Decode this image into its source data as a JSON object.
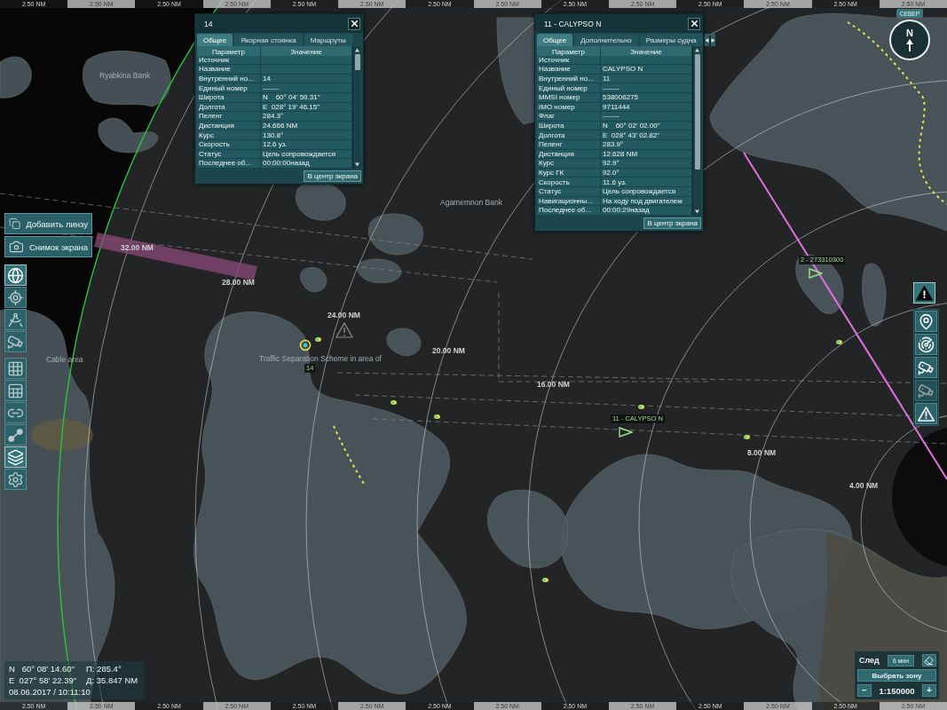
{
  "scale_bar_top": {
    "segments": [
      "2.50 NM",
      "2.50 NM",
      "2.50 NM",
      "2.50 NM",
      "2.50 NM",
      "2.50 NM",
      "2.50 NM",
      "2.50 NM",
      "2.50 NM",
      "2.50 NM",
      "2.50 NM",
      "2.50 NM",
      "2.50 NM",
      "2.50 NM"
    ]
  },
  "compass": {
    "badge": "СЕВЕР",
    "letter": "N"
  },
  "chart": {
    "place_names": [
      "Ryabkina Bank",
      "Agamemnon Bank",
      "Cable area",
      "Traffic Separation Scheme in area of"
    ],
    "range_labels": [
      "32.00 NM",
      "28.00 NM",
      "24.00 NM",
      "20.00 NM",
      "16.00 NM",
      "8.00 NM",
      "4.00 NM"
    ],
    "targets": [
      {
        "label": "14",
        "kind": "radar"
      },
      {
        "label": "11 - CALYPSO N",
        "kind": "ais"
      },
      {
        "label": "2 - 273310300",
        "kind": "ais"
      }
    ]
  },
  "windows": [
    {
      "title": "14",
      "tabs": [
        {
          "label": "Общее",
          "selected": true
        },
        {
          "label": "Якорная стоянка",
          "selected": false
        },
        {
          "label": "Маршруты",
          "selected": false
        }
      ],
      "tab_arrows": false,
      "columns": [
        "Параметр",
        "Значение"
      ],
      "rows": [
        {
          "parameter": "Источник"
        },
        {
          "parameter": "Название"
        },
        {
          "parameter": "Внутренний но...",
          "value": "14"
        },
        {
          "parameter": "Единый номер",
          "value": "-------"
        },
        {
          "parameter": "Широта",
          "value": "N    60° 04' 59.31\""
        },
        {
          "parameter": "Долгота",
          "value": "E  028° 19' 46.15\""
        },
        {
          "parameter": "Пеленг",
          "value": "284.3°"
        },
        {
          "parameter": "Дистанция",
          "value": "24.666 NM"
        },
        {
          "parameter": "Курс",
          "value": "130.8°"
        },
        {
          "parameter": "Скорость",
          "value": "12.6 уз."
        },
        {
          "parameter": "Статус",
          "value": "Цель сопровождается"
        },
        {
          "parameter": "Последнее об...",
          "value": "00:00:00назад"
        }
      ],
      "button": "В центр экрана"
    },
    {
      "title": "11 - CALYPSO N",
      "tabs": [
        {
          "label": "Общее",
          "selected": true
        },
        {
          "label": "Дополнительно",
          "selected": false
        },
        {
          "label": "Размеры судна",
          "selected": false
        }
      ],
      "tab_arrows": true,
      "columns": [
        "Параметр",
        "Значение"
      ],
      "rows": [
        {
          "parameter": "Источник"
        },
        {
          "parameter": "Название",
          "value": "CALYPSO N"
        },
        {
          "parameter": "Внутренний но...",
          "value": "11"
        },
        {
          "parameter": "Единый номер",
          "value": "-------"
        },
        {
          "parameter": "MMSI номер",
          "value": "538006275"
        },
        {
          "parameter": "IMO номер",
          "value": "9711444"
        },
        {
          "parameter": "Флаг",
          "value": "-------"
        },
        {
          "parameter": "Широта",
          "value": "N    60° 02' 02.00\""
        },
        {
          "parameter": "Долгота",
          "value": "E  028° 43' 02.82\""
        },
        {
          "parameter": "Пеленг",
          "value": "283.9°"
        },
        {
          "parameter": "Дистанция",
          "value": "12.628 NM"
        },
        {
          "parameter": "Курс",
          "value": "92.9°"
        },
        {
          "parameter": "Курс ГК",
          "value": "92.0°"
        },
        {
          "parameter": "Скорость",
          "value": "11.6 уз."
        },
        {
          "parameter": "Статус",
          "value": "Цель сопровождается"
        },
        {
          "parameter": "Навигационны...",
          "value": "На ходу под двигателем"
        },
        {
          "parameter": "Последнее об...",
          "value": "00:00:29назад"
        }
      ],
      "button": "В центр экрана"
    }
  ],
  "left_toolbar": {
    "actions": [
      {
        "label": "Добавить линзу"
      },
      {
        "label": "Снимок экрана"
      }
    ],
    "tools": [
      {
        "active": true
      },
      {
        "active": false
      },
      {
        "active": false
      },
      {
        "active": false
      },
      {
        "active": false
      },
      {
        "active": false
      },
      {
        "active": false
      },
      {
        "active": false
      },
      {
        "active": true
      },
      {
        "active": false
      }
    ]
  },
  "right_toolbar": {
    "tools": [
      {
        "active": true,
        "disabled": false
      },
      {
        "active": false,
        "disabled": false
      },
      {
        "active": false,
        "disabled": false
      },
      {
        "active": false,
        "disabled": false
      },
      {
        "active": false,
        "disabled": true
      },
      {
        "active": false,
        "disabled": false
      }
    ]
  },
  "cursor_readout": {
    "latitude": "N   60° 08' 14.60\"",
    "bearing": "П: 285.4°",
    "longitude": "E  027° 58' 22.39\"",
    "distance": "Д: 35.847 NM",
    "datetime": "08.06.2017 / 10:11:10"
  },
  "trail_panel": {
    "label": "След",
    "duration": "6 мин",
    "zone_button": "Выбрать зону",
    "zoom_out": "−",
    "scale": "1:150000",
    "zoom_in": "+"
  },
  "scale_bar_bottom": {
    "segments": [
      "2.50 NM",
      "2.50 NM",
      "2.50 NM",
      "2.50 NM",
      "2.50 NM",
      "2.50 NM",
      "2.50 NM",
      "2.50 NM",
      "2.50 NM",
      "2.50 NM",
      "2.50 NM",
      "2.50 NM",
      "2.50 NM",
      "2.50 NM"
    ]
  }
}
